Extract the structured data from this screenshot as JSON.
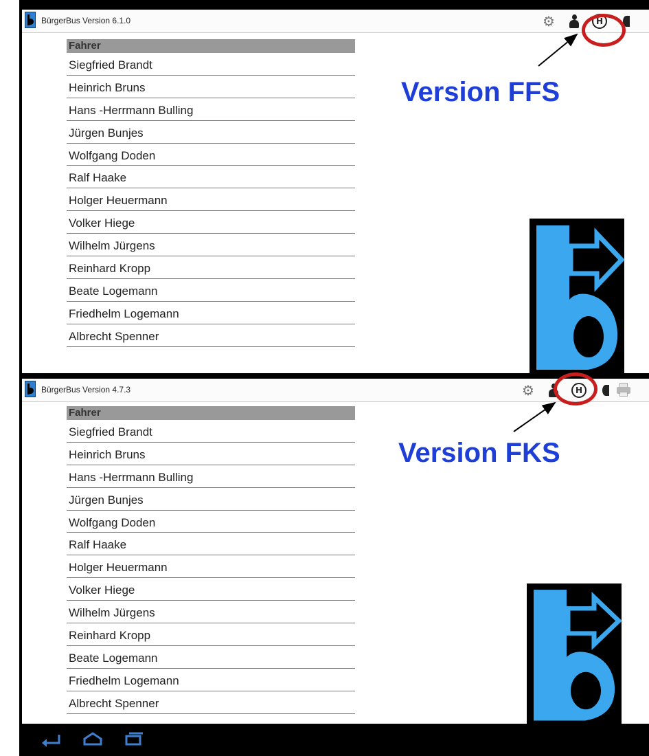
{
  "colors": {
    "annotation_blue": "#1d3fd8",
    "highlight_red": "#c81e1e",
    "logo_blue": "#3aa7ef",
    "logo_bg": "#000000",
    "header_grey": "#999999"
  },
  "screens": [
    {
      "app_title": "BürgerBus Version 6.1.0",
      "toolbar_icons": [
        "gear-icon",
        "person-icon",
        "haltestelle-icon",
        "edge-icon"
      ],
      "haltestelle_glyph": "H",
      "list_header": "Fahrer",
      "drivers": [
        "Siegfried Brandt",
        "Heinrich Bruns",
        "Hans -Herrmann Bulling",
        "Jürgen Bunjes",
        "Wolfgang Doden",
        "Ralf Haake",
        "Holger Heuermann",
        "Volker Hiege",
        "Wilhelm Jürgens",
        "Reinhard Kropp",
        "Beate Logemann",
        "Friedhelm Logemann",
        "Albrecht Spenner"
      ],
      "version_label": "Version FFS"
    },
    {
      "app_title": "BürgerBus Version 4.7.3",
      "toolbar_icons": [
        "gear-icon",
        "person-icon",
        "haltestelle-icon",
        "edge-icon",
        "printer-icon"
      ],
      "haltestelle_glyph": "H",
      "list_header": "Fahrer",
      "drivers": [
        "Siegfried Brandt",
        "Heinrich Bruns",
        "Hans -Herrmann Bulling",
        "Jürgen Bunjes",
        "Wolfgang Doden",
        "Ralf Haake",
        "Holger Heuermann",
        "Volker Hiege",
        "Wilhelm Jürgens",
        "Reinhard Kropp",
        "Beate Logemann",
        "Friedhelm Logemann",
        "Albrecht Spenner"
      ],
      "version_label": "Version FKS"
    }
  ],
  "navbar": {
    "icons": [
      "back-icon",
      "home-icon",
      "recent-apps-icon"
    ]
  }
}
